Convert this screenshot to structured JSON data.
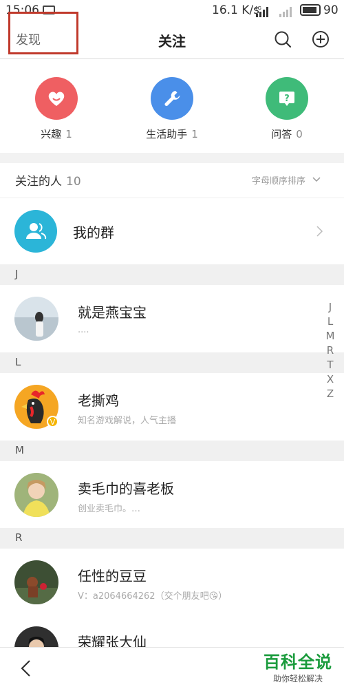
{
  "status_bar": {
    "time": "15:06",
    "speed": "16.1 K/s",
    "network": "4G",
    "battery": "90"
  },
  "nav": {
    "discover": "发现",
    "title": "关注"
  },
  "categories": [
    {
      "label": "兴趣",
      "count": "1",
      "color": "#ef5f62",
      "icon": "heart-icon"
    },
    {
      "label": "生活助手",
      "count": "1",
      "color": "#4a8fe9",
      "icon": "wrench-icon"
    },
    {
      "label": "问答",
      "count": "0",
      "color": "#3fbb79",
      "icon": "question-icon"
    }
  ],
  "following": {
    "title": "关注的人",
    "count": "10",
    "sort_label": "字母顺序排序"
  },
  "group": {
    "label": "我的群"
  },
  "sections": [
    "J",
    "L",
    "M",
    "R"
  ],
  "contacts": [
    {
      "name": "就是燕宝宝",
      "sub": "....",
      "avatar": "#c7d6e2"
    },
    {
      "name": "老撕鸡",
      "sub": "知名游戏解说，人气主播",
      "avatar": "#f5a623",
      "verified": "V"
    },
    {
      "name": "卖毛巾的喜老板",
      "sub": "创业卖毛巾。…",
      "avatar": "#c9c65a"
    },
    {
      "name": "任性的豆豆",
      "sub": "V：a2064664262（交个朋友吧😘）",
      "avatar": "#4a5a3a"
    },
    {
      "name": "荣耀张大仙",
      "sub": "",
      "avatar": "#2f2f2f"
    }
  ],
  "alpha_index": [
    "J",
    "L",
    "M",
    "R",
    "T",
    "X",
    "Z"
  ],
  "watermark": {
    "title": "百科全说",
    "subtitle": "助你轻松解决"
  }
}
